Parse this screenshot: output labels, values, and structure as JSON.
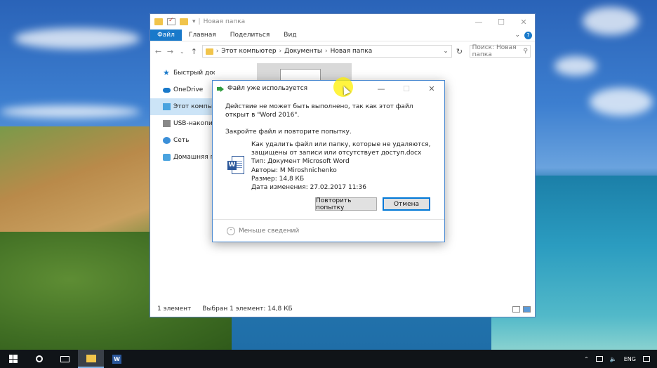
{
  "explorer": {
    "title": "Новая папка",
    "ribbon_tabs": [
      "Файл",
      "Главная",
      "Поделиться",
      "Вид"
    ],
    "address": [
      "Этот компьютер",
      "Документы",
      "Новая папка"
    ],
    "search_placeholder": "Поиск: Новая папка",
    "sidebar": [
      "Быстрый доступ",
      "OneDrive",
      "Этот компьютер",
      "USB-накопитель",
      "Сеть",
      "Домашняя группа"
    ],
    "status_count": "1 элемент",
    "status_selected": "Выбран 1 элемент: 14,8 КБ"
  },
  "dialog": {
    "title": "Файл уже используется",
    "message": "Действие не может быть выполнено, так как этот файл открыт в \"Word 2016\".",
    "hint": "Закройте файл и повторите попытку.",
    "file_name": "Как удалить файл или папку, которые не удаляются, защищены от записи или отсутствует доступ.docx",
    "file_type": "Тип: Документ Microsoft Word",
    "authors": "Авторы: M Miroshnichenko",
    "size": "Размер: 14,8 КБ",
    "modified": "Дата изменения: 27.02.2017 11:36",
    "retry_label": "Повторить попытку",
    "cancel_label": "Отмена",
    "less_details": "Меньше сведений"
  },
  "taskbar": {
    "language": "ENG"
  }
}
